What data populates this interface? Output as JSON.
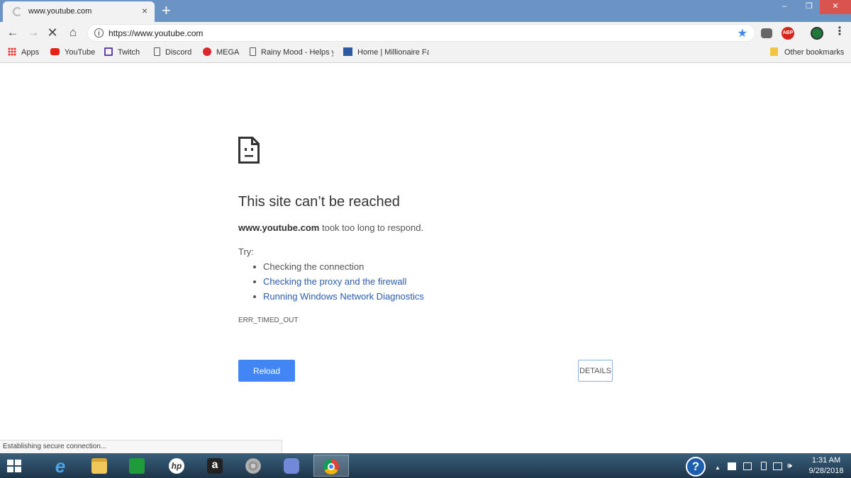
{
  "browser": {
    "tab": {
      "title": "www.youtube.com",
      "close": "×"
    },
    "new_tab": "+",
    "window_controls": {
      "minimize": "‒",
      "maximize": "❐",
      "close": "✕"
    },
    "toolbar": {
      "back": "←",
      "forward": "→",
      "stop": "✕",
      "home": "⌂",
      "info": "i",
      "url": "https://www.youtube.com",
      "bookmark_star": "★",
      "abp": "ABP",
      "menu": "⋮"
    },
    "bookmarks": [
      {
        "label": "Apps",
        "icon": "apps-grid-icon"
      },
      {
        "label": "YouTube",
        "icon": "youtube-icon"
      },
      {
        "label": "Twitch",
        "icon": "twitch-icon"
      },
      {
        "label": "Discord",
        "icon": "page-icon"
      },
      {
        "label": "MEGA",
        "icon": "mega-icon"
      },
      {
        "label": "Rainy Mood - Helps y",
        "icon": "page-icon"
      },
      {
        "label": "Home | Millionaire Fa",
        "icon": "millionaire-icon"
      }
    ],
    "other_bookmarks": "Other bookmarks",
    "status": "Establishing secure connection..."
  },
  "error_page": {
    "title": "This site can’t be reached",
    "host": "www.youtube.com",
    "message": "took too long to respond.",
    "try_label": "Try:",
    "suggestions": [
      "Checking the connection",
      "Checking the proxy and the firewall",
      "Running Windows Network Diagnostics"
    ],
    "error_code": "ERR_TIMED_OUT",
    "reload_label": "Reload",
    "details_label": "DETAILS"
  },
  "taskbar": {
    "apps": [
      "start",
      "internet-explorer",
      "file-explorer",
      "windows-store",
      "hp",
      "amazon",
      "speaker",
      "discord",
      "chrome"
    ],
    "ie_glyph": "e",
    "hp_glyph": "hp",
    "amazon_glyph": "a",
    "help": "?",
    "tray_up": "▲",
    "volume": "🕪",
    "time": "1:31 AM",
    "date": "9/28/2018"
  },
  "colors": {
    "tab_strip": "#6b94c4",
    "accent": "#4285f4",
    "link": "#2a5db0"
  }
}
